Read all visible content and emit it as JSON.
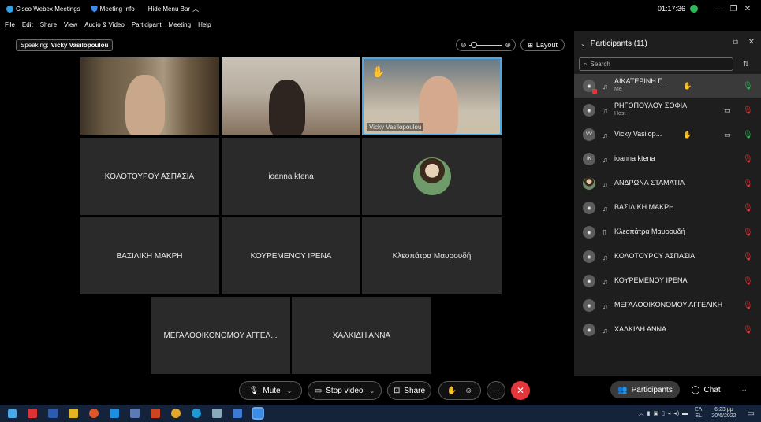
{
  "titlebar": {
    "app_name": "Cisco Webex Meetings",
    "meeting_info": "Meeting Info",
    "hide_menu": "Hide Menu Bar",
    "timer": "01:17:36"
  },
  "menu": [
    "File",
    "Edit",
    "Share",
    "View",
    "Audio & Video",
    "Participant",
    "Meeting",
    "Help"
  ],
  "stage": {
    "speaking_label": "Speaking:",
    "speaking_name": "Vicky Vasilopoulou",
    "layout_label": "Layout",
    "video_tag": "Vicky Vasilopoulou",
    "tiles": [
      "ΚΟΛΟΤΟΥΡΟΥ ΑΣΠΑΣΙΑ",
      "ioanna ktena",
      "ΒΑΣΙΛΙΚΗ ΜΑΚΡΗ",
      "ΚΟΥΡΕΜΕΝΟΥ ΙΡΕΝΑ",
      "Κλεοπάτρα Μαυρουδή",
      "ΜΕΓΑΛΟΟΙΚΟΝΟΜΟΥ ΑΓΓΕΛ...",
      "ΧΑΛΚΙΔΗ ΑΝΝΑ"
    ]
  },
  "toolbar": {
    "mute": "Mute",
    "stop_video": "Stop video",
    "share": "Share"
  },
  "panel": {
    "title": "Participants (11)",
    "search_placeholder": "Search",
    "participants": [
      {
        "initials": "",
        "name": "ΑΙΚΑΤΕΡΙΝΗ Γ...",
        "sub": "Me"
      },
      {
        "initials": "",
        "name": "ΡΗΓΟΠΟΥΛΟΥ ΣΟΦΙΑ",
        "sub": "Host"
      },
      {
        "initials": "VV",
        "name": "Vicky Vasilop...",
        "sub": ""
      },
      {
        "initials": "IK",
        "name": "ioanna ktena",
        "sub": ""
      },
      {
        "initials": "",
        "name": "ΑΝΔΡΩΝΑ ΣΤΑΜΑΤΙΑ",
        "sub": ""
      },
      {
        "initials": "",
        "name": "ΒΑΣΙΛΙΚΗ ΜΑΚΡΗ",
        "sub": ""
      },
      {
        "initials": "",
        "name": "Κλεοπάτρα Μαυρουδή",
        "sub": ""
      },
      {
        "initials": "",
        "name": "ΚΟΛΟΤΟΥΡΟΥ ΑΣΠΑΣΙΑ",
        "sub": ""
      },
      {
        "initials": "",
        "name": "ΚΟΥΡΕΜΕΝΟΥ ΙΡΕΝΑ",
        "sub": ""
      },
      {
        "initials": "",
        "name": "ΜΕΓΑΛΟΟΙΚΟΝΟΜΟΥ ΑΓΓΕΛΙΚΗ",
        "sub": ""
      },
      {
        "initials": "",
        "name": "ΧΑΛΚΙΔΗ ΑΝΝΑ",
        "sub": ""
      }
    ],
    "tab_participants": "Participants",
    "tab_chat": "Chat"
  },
  "taskbar": {
    "lang_1": "ΕΛ",
    "lang_2": "EL",
    "time": "6:23 μμ",
    "date": "20/6/2022"
  },
  "colors": {
    "accent_blue": "#4aa8e8",
    "end_red": "#e5373b",
    "mic_live_green": "#2fb55a",
    "panel_bg": "#1e1e1e",
    "tile_bg": "#2a2a2a"
  }
}
